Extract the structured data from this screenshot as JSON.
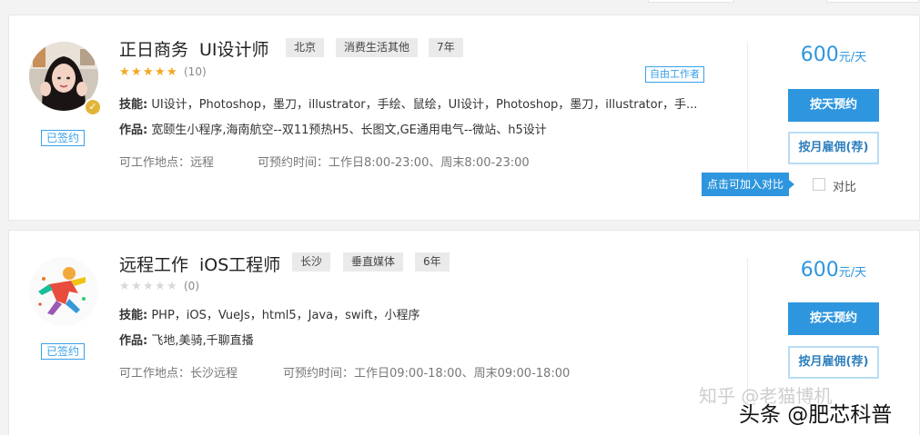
{
  "cards": [
    {
      "title_part1": "正日商务",
      "title_part2": "UI设计师",
      "tags": [
        "北京",
        "消费生活其他",
        "7年"
      ],
      "rating_stars": 5,
      "rating_max": 5,
      "rating_count": "(10)",
      "freelancer_badge": "自由工作者",
      "skills_label": "技能:",
      "skills": "UI设计，Photoshop，墨刀，illustrator，手绘、鼠绘，UI设计，Photoshop，墨刀，illustrator，手...",
      "works_label": "作品:",
      "works": "宽颐生小程序,海南航空--双11预热H5、长图文,GE通用电气--微站、h5设计",
      "location": "可工作地点：远程",
      "availability": "可预约时间：工作日8:00-23:00、周末8:00-23:00",
      "signed_label": "已签约",
      "price_number": "600",
      "price_unit": "元/天",
      "book_daily_label": "按天预约",
      "hire_monthly_label": "按月雇佣(荐)",
      "compare_tooltip": "点击可加入对比",
      "compare_label": "对比"
    },
    {
      "title_part1": "远程工作",
      "title_part2": "iOS工程师",
      "tags": [
        "长沙",
        "垂直媒体",
        "6年"
      ],
      "rating_stars": 0,
      "rating_max": 5,
      "rating_count": "(0)",
      "skills_label": "技能:",
      "skills": "PHP，iOS，VueJs，html5，Java，swift，小程序",
      "works_label": "作品:",
      "works": "飞地,美骑,千聊直播",
      "location": "可工作地点：长沙远程",
      "availability": "可预约时间：工作日09:00-18:00、周末09:00-18:00",
      "signed_label": "已签约",
      "price_number": "600",
      "price_unit": "元/天",
      "book_daily_label": "按天预约",
      "hire_monthly_label": "按月雇佣(荐)"
    }
  ],
  "watermark_zhihu": "知乎 @老猫博机",
  "watermark_toutiao": "头条 @肥芯科普",
  "colors": {
    "primary": "#2e96de",
    "star_on": "#f5a623",
    "star_off": "#d8d8d8",
    "verified": "#e2b53a"
  }
}
